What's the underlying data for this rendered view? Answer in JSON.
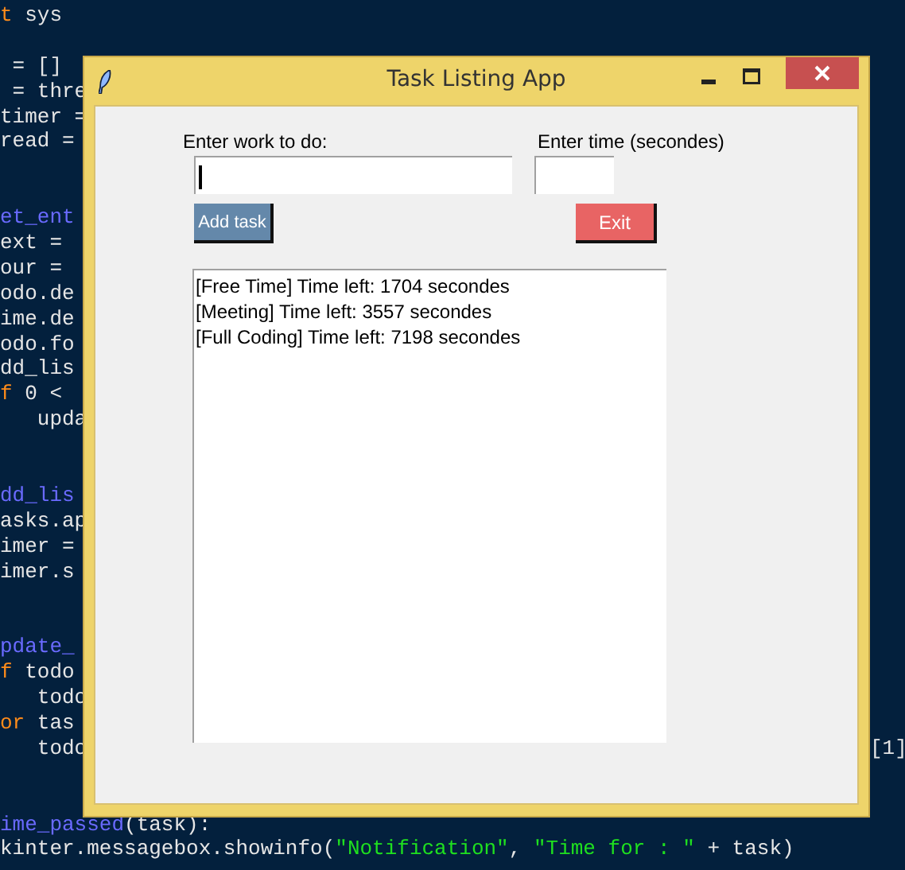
{
  "editor": {
    "lines": [
      {
        "kind": "code",
        "segments": [
          {
            "kind": "keyword",
            "text": "t"
          },
          {
            "kind": "plain",
            "text": " sys"
          }
        ]
      },
      {
        "kind": "blank"
      },
      {
        "kind": "code",
        "segments": [
          {
            "kind": "plain",
            "text": " = []"
          }
        ]
      },
      {
        "kind": "code",
        "segments": [
          {
            "kind": "plain",
            "text": " = thre"
          }
        ]
      },
      {
        "kind": "code",
        "segments": [
          {
            "kind": "plain",
            "text": "timer ="
          }
        ]
      },
      {
        "kind": "code",
        "segments": [
          {
            "kind": "plain",
            "text": "read ="
          }
        ]
      },
      {
        "kind": "blank"
      },
      {
        "kind": "blank"
      },
      {
        "kind": "code",
        "segments": [
          {
            "kind": "name",
            "text": "et_ent"
          }
        ]
      },
      {
        "kind": "code",
        "segments": [
          {
            "kind": "plain",
            "text": "ext ="
          }
        ]
      },
      {
        "kind": "code",
        "segments": [
          {
            "kind": "plain",
            "text": "our ="
          }
        ]
      },
      {
        "kind": "code",
        "segments": [
          {
            "kind": "plain",
            "text": "odo.de"
          }
        ]
      },
      {
        "kind": "code",
        "segments": [
          {
            "kind": "plain",
            "text": "ime.de"
          }
        ]
      },
      {
        "kind": "code",
        "segments": [
          {
            "kind": "plain",
            "text": "odo.fo"
          }
        ]
      },
      {
        "kind": "code",
        "segments": [
          {
            "kind": "plain",
            "text": "dd_lis"
          }
        ]
      },
      {
        "kind": "code",
        "segments": [
          {
            "kind": "keyword",
            "text": "f"
          },
          {
            "kind": "plain",
            "text": " 0 <"
          }
        ]
      },
      {
        "kind": "code",
        "segments": [
          {
            "kind": "plain",
            "text": "   upda"
          }
        ]
      },
      {
        "kind": "blank"
      },
      {
        "kind": "blank"
      },
      {
        "kind": "code",
        "segments": [
          {
            "kind": "name",
            "text": "dd_lis"
          }
        ]
      },
      {
        "kind": "code",
        "segments": [
          {
            "kind": "plain",
            "text": "asks.ap"
          }
        ]
      },
      {
        "kind": "code",
        "segments": [
          {
            "kind": "plain",
            "text": "imer ="
          }
        ]
      },
      {
        "kind": "code",
        "segments": [
          {
            "kind": "plain",
            "text": "imer.s"
          }
        ]
      },
      {
        "kind": "blank"
      },
      {
        "kind": "blank"
      },
      {
        "kind": "code",
        "segments": [
          {
            "kind": "name",
            "text": "pdate_"
          }
        ]
      },
      {
        "kind": "code",
        "segments": [
          {
            "kind": "keyword",
            "text": "f"
          },
          {
            "kind": "plain",
            "text": " todo"
          }
        ]
      },
      {
        "kind": "code",
        "segments": [
          {
            "kind": "plain",
            "text": "   todo"
          }
        ]
      },
      {
        "kind": "code",
        "segments": [
          {
            "kind": "keyword",
            "text": "or"
          },
          {
            "kind": "plain",
            "text": " tas"
          }
        ]
      },
      {
        "kind": "code",
        "segments": [
          {
            "kind": "plain",
            "text": "   todo"
          }
        ],
        "right": "[1]"
      },
      {
        "kind": "blank"
      },
      {
        "kind": "blank"
      },
      {
        "kind": "code",
        "segments": [
          {
            "kind": "name",
            "text": "ime_passed"
          },
          {
            "kind": "plain",
            "text": "(task):"
          }
        ]
      },
      {
        "kind": "code",
        "segments": [
          {
            "kind": "plain",
            "text": "kinter.messagebox.showinfo("
          },
          {
            "kind": "string",
            "text": "\"Notification\""
          },
          {
            "kind": "plain",
            "text": ", "
          },
          {
            "kind": "string",
            "text": "\"Time for : \""
          },
          {
            "kind": "plain",
            "text": " + task)"
          }
        ]
      }
    ]
  },
  "window": {
    "title": "Task Listing App",
    "work_label": "Enter work to do:",
    "time_label": "Enter time (secondes)",
    "work_field": {
      "focused": true
    },
    "buttons": [
      {
        "label": "Add task",
        "kind": "add"
      },
      {
        "label": "Exit",
        "kind": "exit"
      }
    ],
    "list": [
      "[Free Time] Time left: 1704 secondes",
      "[Meeting] Time left: 3557 secondes",
      "[Full Coding] Time left: 7198 secondes"
    ]
  }
}
